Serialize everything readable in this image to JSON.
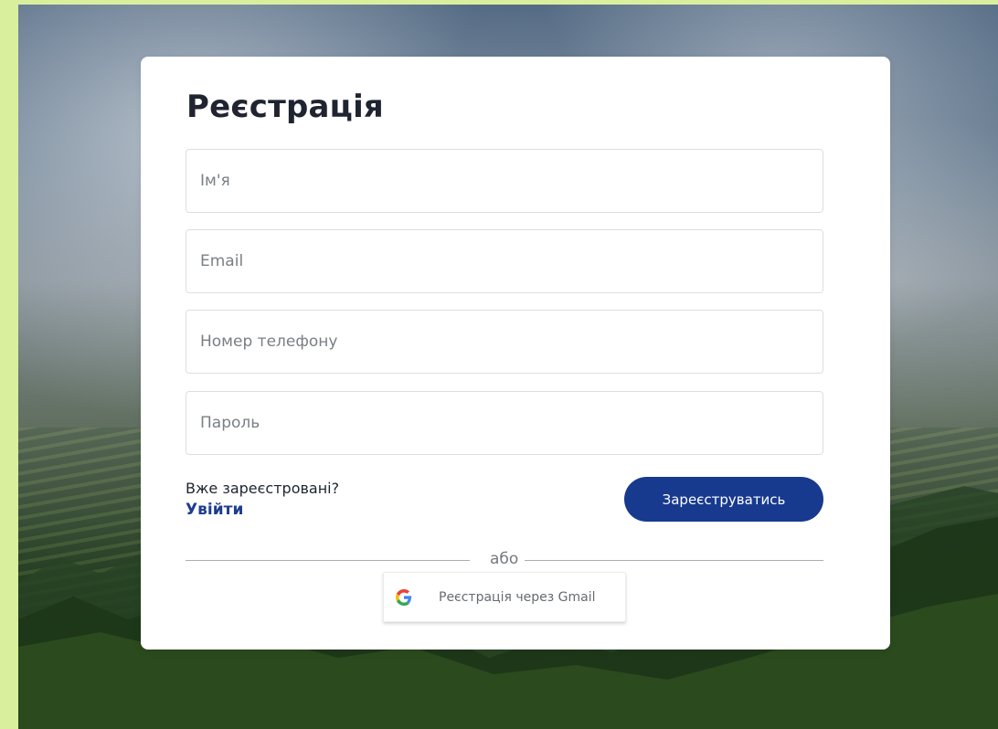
{
  "form": {
    "title": "Реєстрація",
    "fields": {
      "name_placeholder": "Ім'я",
      "email_placeholder": "Email",
      "phone_placeholder": "Номер телефону",
      "password_placeholder": "Пароль"
    },
    "login": {
      "prompt": "Вже зареєстровані?",
      "link_label": "Увійти"
    },
    "actions": {
      "register_label": "Зареєструватись",
      "divider_text": "або",
      "gmail_label": "Реєстрація через Gmail"
    }
  },
  "icons": {
    "google": "google-icon"
  },
  "colors": {
    "background_outer": "#d9ef9e",
    "card_background": "#ffffff",
    "title": "#1f2430",
    "link": "#1e3d8d",
    "button": "#173a8e",
    "button_text": "#ffffff",
    "placeholder": "#7a7f85",
    "border": "#dadfe5",
    "divider": "#a8aeb5"
  }
}
